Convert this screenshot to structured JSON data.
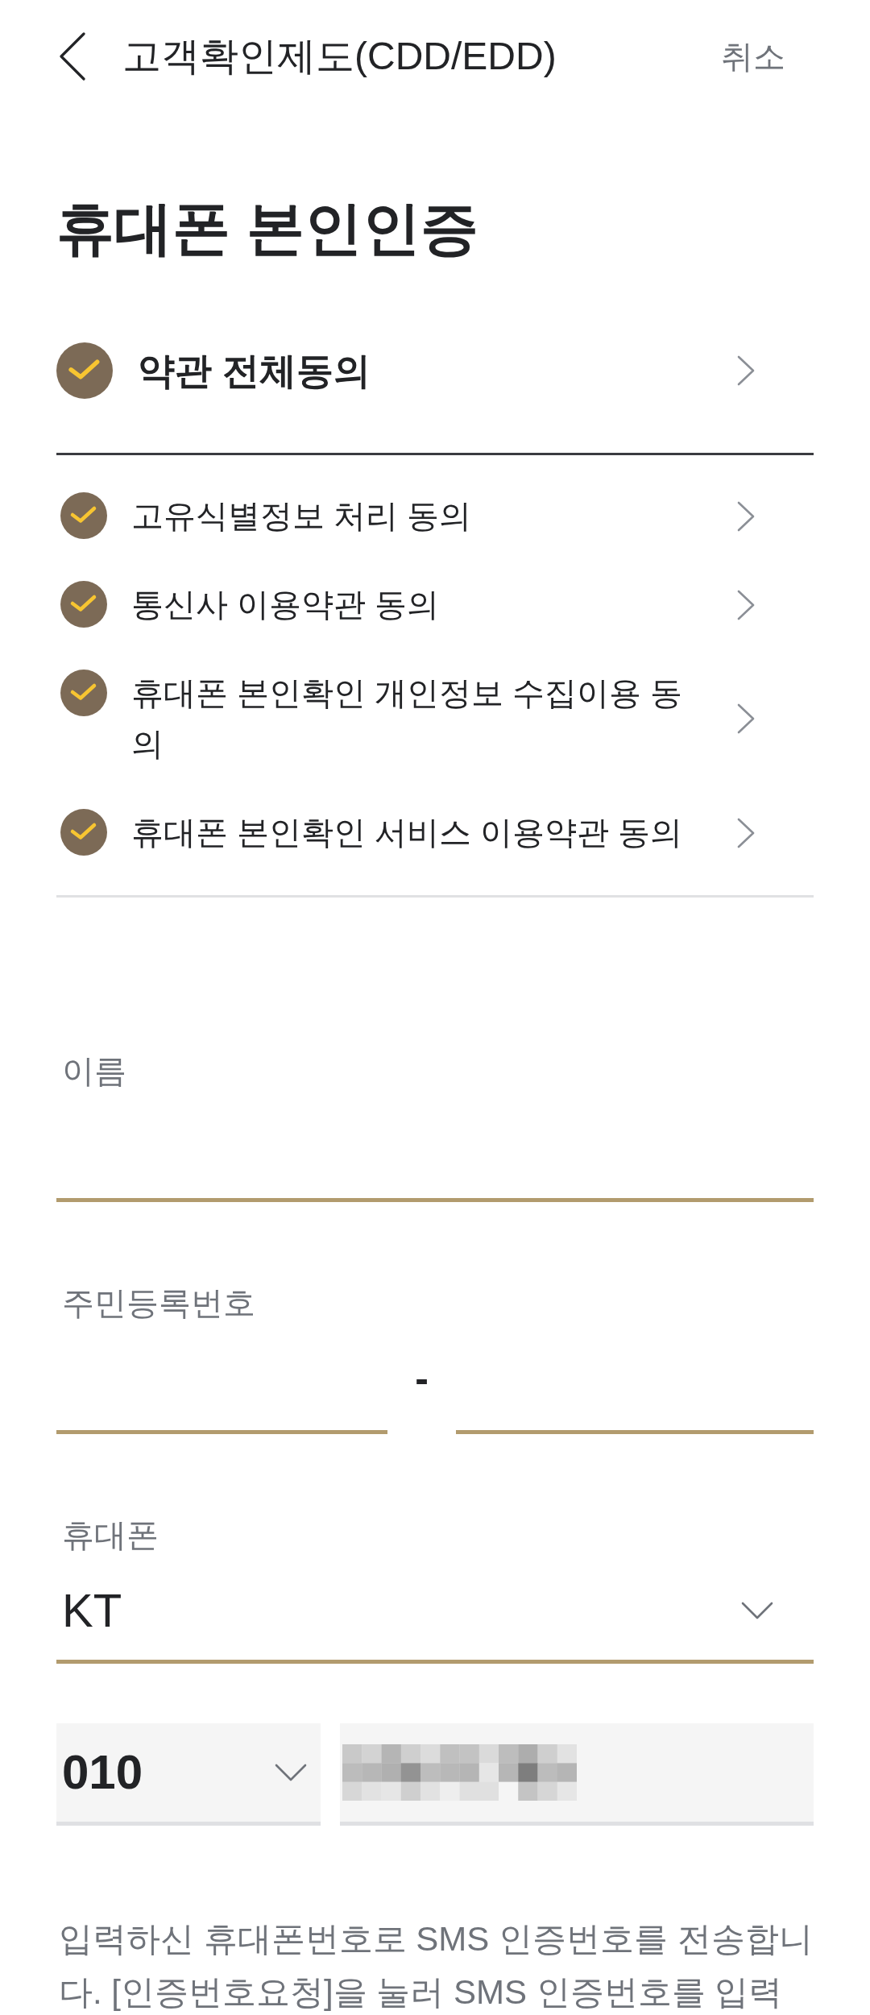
{
  "header": {
    "title": "고객확인제도(CDD/EDD)",
    "action": "취소"
  },
  "page_title": "휴대폰 본인인증",
  "agree_all": {
    "label": "약관 전체동의",
    "checked": true
  },
  "terms": [
    {
      "label": "고유식별정보 처리 동의",
      "checked": true
    },
    {
      "label": "통신사 이용약관 동의",
      "checked": true
    },
    {
      "label": "휴대폰 본인확인 개인정보 수집이용 동의",
      "checked": true
    },
    {
      "label": "휴대폰 본인확인 서비스 이용약관 동의",
      "checked": true
    }
  ],
  "fields": [
    {
      "kind": "text",
      "label": "이름"
    },
    {
      "kind": "split",
      "label": "주민등록번호",
      "separator": "-"
    },
    {
      "kind": "select",
      "label": "휴대폰",
      "value": "KT"
    }
  ],
  "phone": {
    "prefix": "010"
  },
  "notice": "입력하신 휴대폰번호로 SMS 인증번호를 전송합니다. [인증번호요청]을 눌러 SMS 인증번호를 입력"
}
